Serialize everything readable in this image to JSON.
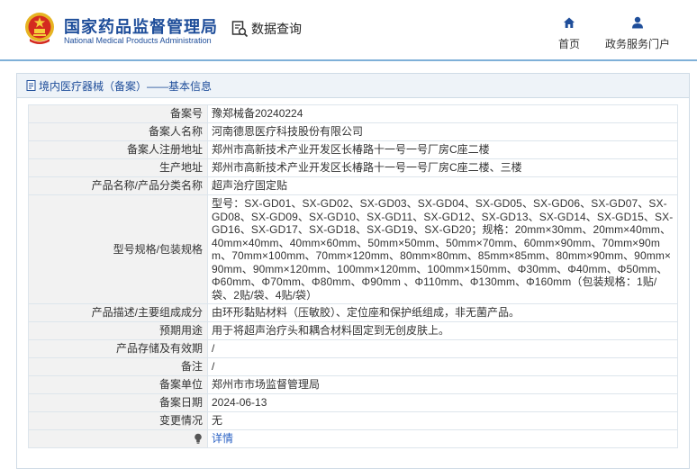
{
  "header": {
    "title_cn": "国家药品监督管理局",
    "title_en": "National Medical Products Administration",
    "query_label": "数据查询",
    "nav": [
      {
        "label": "首页",
        "icon": "home-icon"
      },
      {
        "label": "政务服务门户",
        "icon": "user-icon"
      }
    ]
  },
  "breadcrumb": "境内医疗器械（备案）——基本信息",
  "record": {
    "rows": [
      {
        "key": "备案号",
        "value": "豫郑械备20240224"
      },
      {
        "key": "备案人名称",
        "value": "河南德恩医疗科技股份有限公司"
      },
      {
        "key": "备案人注册地址",
        "value": "郑州市高新技术产业开发区长椿路十一号一号厂房C座二楼"
      },
      {
        "key": "生产地址",
        "value": "郑州市高新技术产业开发区长椿路十一号一号厂房C座二楼、三楼"
      },
      {
        "key": "产品名称/产品分类名称",
        "value": "超声治疗固定贴"
      },
      {
        "key": "型号规格/包装规格",
        "value": "型号：SX-GD01、SX-GD02、SX-GD03、SX-GD04、SX-GD05、SX-GD06、SX-GD07、SX-GD08、SX-GD09、SX-GD10、SX-GD11、SX-GD12、SX-GD13、SX-GD14、SX-GD15、SX-GD16、SX-GD17、SX-GD18、SX-GD19、SX-GD20；规格：20mm×30mm、20mm×40mm、40mm×40mm、40mm×60mm、50mm×50mm、50mm×70mm、60mm×90mm、70mm×90mm、70mm×100mm、70mm×120mm、80mm×80mm、85mm×85mm、80mm×90mm、90mm×90mm、90mm×120mm、100mm×120mm、100mm×150mm、Φ30mm、Φ40mm、Φ50mm、Φ60mm、Φ70mm、Φ80mm、Φ90mm 、Φ110mm、Φ130mm、Φ160mm（包装规格：1贴/袋、2贴/袋、4贴/袋）"
      },
      {
        "key": "产品描述/主要组成成分",
        "value": "由环形黏贴材料（压敏胶）、定位座和保护纸组成，非无菌产品。"
      },
      {
        "key": "预期用途",
        "value": "用于将超声治疗头和耦合材料固定到无创皮肤上。"
      },
      {
        "key": "产品存储及有效期",
        "value": "/"
      },
      {
        "key": "备注",
        "value": "/"
      },
      {
        "key": "备案单位",
        "value": "郑州市市场监督管理局"
      },
      {
        "key": "备案日期",
        "value": "2024-06-13"
      },
      {
        "key": "变更情况",
        "value": "无"
      }
    ],
    "detail_link": "详情"
  }
}
